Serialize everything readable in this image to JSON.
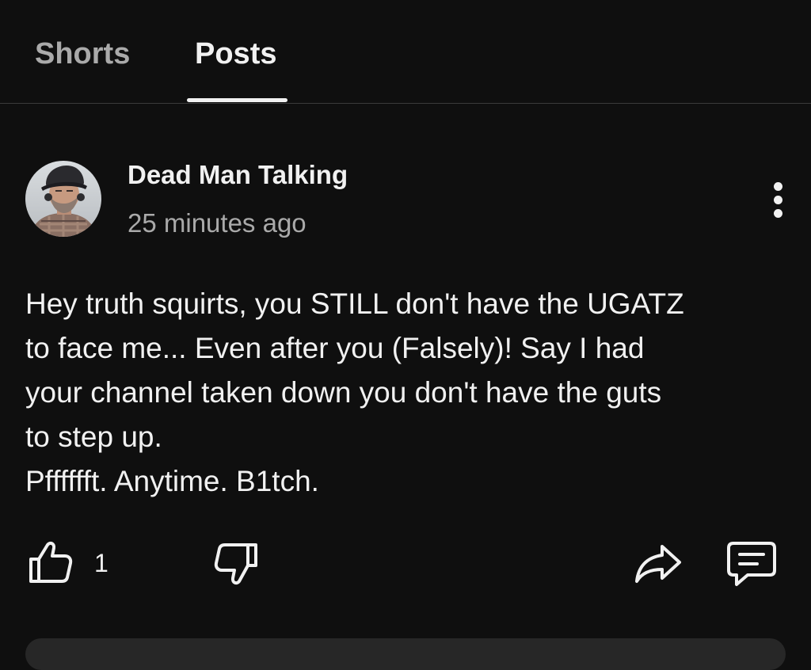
{
  "tabs": {
    "shorts_label": "Shorts",
    "posts_label": "Posts",
    "active": "Posts"
  },
  "post": {
    "author": "Dead Man Talking",
    "time": "25 minutes ago",
    "lines": [
      "Hey truth squirts, you STILL don't have the UGATZ",
      "to face me... Even after you (Falsely)! Say I had",
      "your channel taken down you don't have the guts",
      "to step up.",
      "Pfffffft. Anytime. B1tch."
    ],
    "like_count": "1",
    "icons": {
      "avatar": "avatar-image",
      "more": "more-vert-icon",
      "like": "thumb-up-icon",
      "dislike": "thumb-down-icon",
      "share": "share-icon",
      "comment": "comment-icon"
    }
  },
  "colors": {
    "background": "#0f0f0f",
    "text": "#f1f1f1",
    "secondary_text": "#aaaaaa"
  }
}
